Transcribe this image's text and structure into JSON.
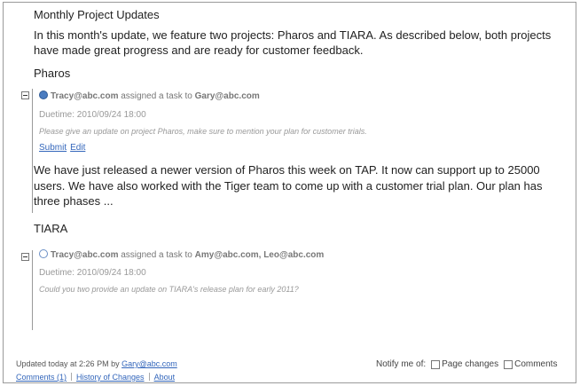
{
  "page": {
    "title": "Monthly Project Updates",
    "intro": "In this month's update, we feature two projects: Pharos and TIARA. As described below, both projects have made great progress and are ready for customer feedback."
  },
  "sections": [
    {
      "title": "Pharos",
      "task": {
        "assigner": "Tracy@abc.com",
        "action": "assigned a task to",
        "assignees": "Gary@abc.com",
        "duetime": "Duetime: 2010/09/24 18:00",
        "description": "Please give an update on project Pharos, make sure to mention your plan for customer trials.",
        "submit_label": "Submit",
        "edit_label": "Edit"
      },
      "body": "We have just released a newer version of Pharos this week on TAP. It now can support up to 25000 users. We have also worked with the Tiger team to come up with a customer trial plan. Our plan has three phases ..."
    },
    {
      "title": "TIARA",
      "task": {
        "assigner": "Tracy@abc.com",
        "action": "assigned a task to",
        "assignees": "Amy@abc.com, Leo@abc.com",
        "duetime": "Duetime: 2010/09/24 18:00",
        "description": "Could you two provide an update on TIARA's release plan for early 2011?"
      }
    }
  ],
  "footer": {
    "updated_prefix": "Updated today at 2:26 PM by",
    "updated_by": "Gary@abc.com",
    "comments_link": "Comments (1)",
    "history_link": "History of Changes",
    "about_link": "About",
    "notify_label": "Notify me of:",
    "page_changes_label": "Page changes",
    "comments_label": "Comments"
  },
  "colors": {
    "link": "#3366bb",
    "status_filled": "#4a7cc0"
  }
}
